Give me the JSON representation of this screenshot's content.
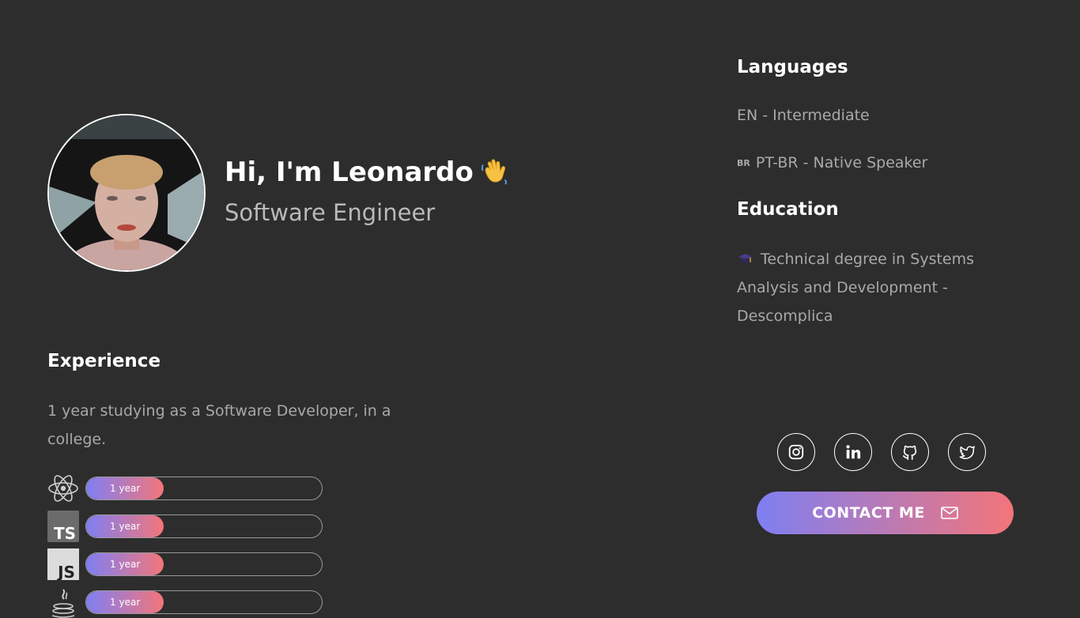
{
  "profile": {
    "greeting": "Hi, I'm Leonardo",
    "role": "Software Engineer",
    "wave_icon": "waving-hand-icon"
  },
  "experience": {
    "title": "Experience",
    "description": "1 year studying as a Software Developer, in a college.",
    "skills": [
      {
        "icon": "react-icon",
        "label": "1 year",
        "level": 0.33
      },
      {
        "icon": "typescript-icon",
        "label": "1 year",
        "level": 0.33
      },
      {
        "icon": "javascript-icon",
        "label": "1 year",
        "level": 0.33
      },
      {
        "icon": "java-icon",
        "label": "1 year",
        "level": 0.33
      }
    ]
  },
  "languages": {
    "title": "Languages",
    "items": [
      {
        "flag": "",
        "text": "EN - Intermediate"
      },
      {
        "flag": "BR",
        "text": "PT-BR - Native Speaker"
      }
    ]
  },
  "education": {
    "title": "Education",
    "icon": "graduation-cap-icon",
    "text": "Technical degree in Systems Analysis and Development - Descomplica"
  },
  "socials": [
    "instagram-icon",
    "linkedin-icon",
    "github-icon",
    "twitter-icon"
  ],
  "contact": {
    "label": "CONTACT ME",
    "icon": "mail-icon"
  },
  "colors": {
    "background": "#2d2d2d",
    "gradient_start": "#7f7ff2",
    "gradient_end": "#f3757a",
    "muted_text": "#a9a9a9"
  }
}
